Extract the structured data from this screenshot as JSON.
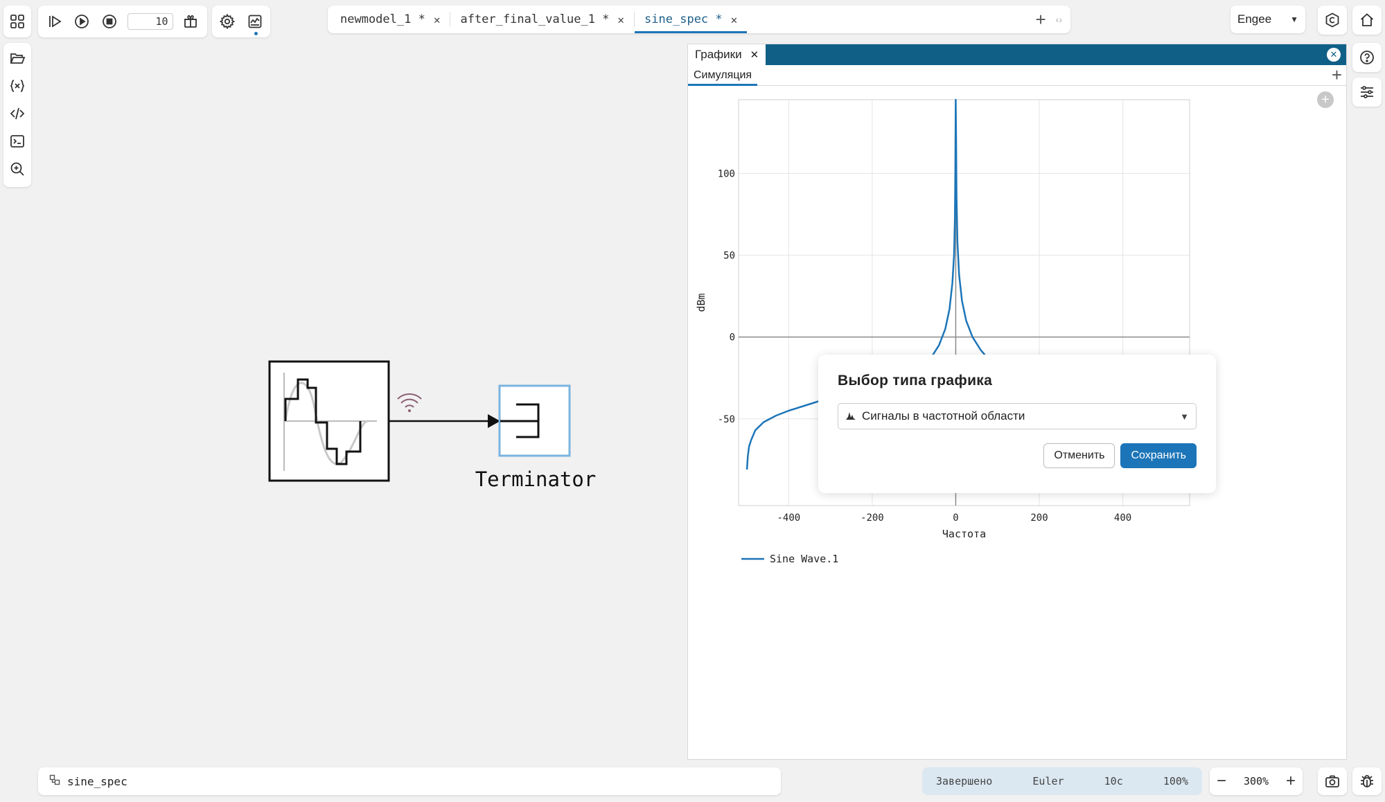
{
  "toolbar": {
    "stop_time": "10"
  },
  "tabs": [
    {
      "label": "newmodel_1 *",
      "close": "✕"
    },
    {
      "label": "after_final_value_1 *",
      "close": "✕"
    },
    {
      "label": "sine_spec *",
      "close": "✕"
    }
  ],
  "engine": {
    "selected": "Engee"
  },
  "canvas": {
    "terminator_label": "Terminator"
  },
  "graph_panel": {
    "tab_label": "Графики",
    "subtab_label": "Симуляция"
  },
  "chart_data": {
    "type": "line",
    "xlabel": "Частота",
    "ylabel": "dBm",
    "xlim": [
      -520,
      560
    ],
    "ylim": [
      -103,
      145
    ],
    "x_ticks": [
      -400,
      -200,
      0,
      200,
      400
    ],
    "y_ticks": [
      -50,
      0,
      50,
      100
    ],
    "grid": true,
    "legend_position": "bottom-left",
    "series": [
      {
        "name": "Sine Wave.1",
        "color": "#1c75b8",
        "x": [
          -500,
          -498,
          -495,
          -490,
          -480,
          -460,
          -430,
          -400,
          -350,
          -300,
          -250,
          -200,
          -150,
          -100,
          -60,
          -40,
          -25,
          -15,
          -8,
          -4,
          -2,
          -1,
          0,
          1,
          2,
          4,
          8,
          15,
          25,
          40,
          60,
          100,
          150,
          200,
          250,
          300,
          350,
          400,
          430,
          460,
          480,
          490,
          495,
          498,
          500,
          502,
          505
        ],
        "y": [
          -81,
          -73,
          -67,
          -63,
          -57,
          -52,
          -48,
          -45,
          -41,
          -37,
          -33,
          -29,
          -25,
          -20,
          -13,
          -5,
          5,
          17,
          33,
          50,
          72,
          100,
          145,
          120,
          85,
          58,
          38,
          22,
          10,
          0,
          -8,
          -20,
          -25,
          -29,
          -33,
          -37,
          -41,
          -45,
          -48,
          -52,
          -57,
          -63,
          -68,
          -73,
          -80,
          -86,
          -93
        ]
      }
    ]
  },
  "dialog": {
    "title": "Выбор типа графика",
    "select_value": "Сигналы в частотной области",
    "cancel_label": "Отменить",
    "save_label": "Сохранить"
  },
  "status": {
    "model_name": "sine_spec",
    "state": "Завершено",
    "solver": "Euler",
    "sim_time": "10с",
    "progress": "100%",
    "zoom": "300%"
  }
}
